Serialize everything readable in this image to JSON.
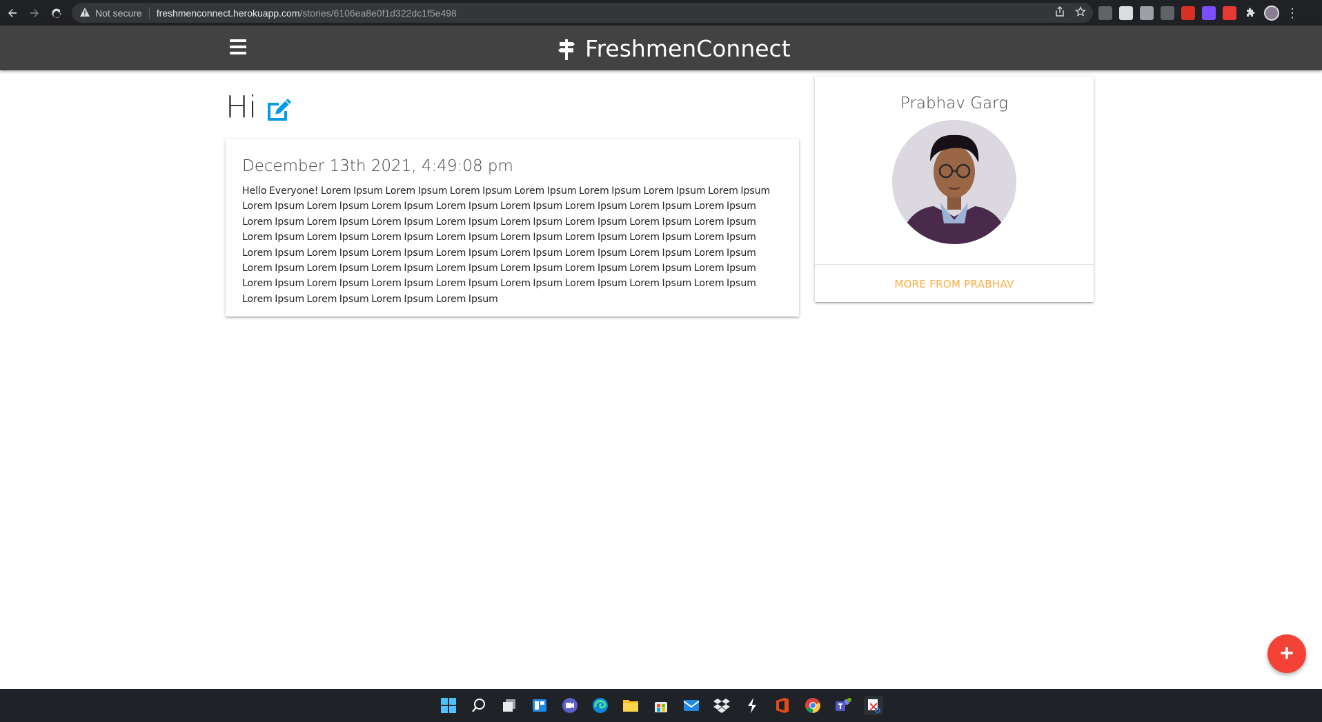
{
  "browser": {
    "security_label": "Not secure",
    "url_domain": "freshmenconnect.herokuapp.com",
    "url_path": "/stories/6106ea8e0f1d322dc1f5e498"
  },
  "navbar": {
    "brand": "FreshmenConnect"
  },
  "story": {
    "title": "Hi",
    "date": "December 13th 2021, 4:49:08 pm",
    "body": "Hello Everyone! Lorem Ipsum Lorem Ipsum Lorem Ipsum Lorem Ipsum Lorem Ipsum Lorem Ipsum Lorem Ipsum Lorem Ipsum Lorem Ipsum Lorem Ipsum Lorem Ipsum Lorem Ipsum Lorem Ipsum Lorem Ipsum Lorem Ipsum Lorem Ipsum Lorem Ipsum Lorem Ipsum Lorem Ipsum Lorem Ipsum Lorem Ipsum Lorem Ipsum Lorem Ipsum Lorem Ipsum Lorem Ipsum Lorem Ipsum Lorem Ipsum Lorem Ipsum Lorem Ipsum Lorem Ipsum Lorem Ipsum Lorem Ipsum Lorem Ipsum Lorem Ipsum Lorem Ipsum Lorem Ipsum Lorem Ipsum Lorem Ipsum Lorem Ipsum Lorem Ipsum Lorem Ipsum Lorem Ipsum Lorem Ipsum Lorem Ipsum Lorem Ipsum Lorem Ipsum Lorem Ipsum Lorem Ipsum Lorem Ipsum Lorem Ipsum Lorem Ipsum Lorem Ipsum Lorem Ipsum Lorem Ipsum Lorem Ipsum Lorem Ipsum Lorem Ipsum Lorem Ipsum Lorem Ipsum"
  },
  "author_card": {
    "name": "Prabhav Garg",
    "more_link": "MORE FROM PRABHAV"
  },
  "fab": {
    "label": "+"
  },
  "colors": {
    "navbar": "#424242",
    "accent_link": "#ffab40",
    "fab": "#f44336",
    "edit_icon": "#039be5"
  }
}
